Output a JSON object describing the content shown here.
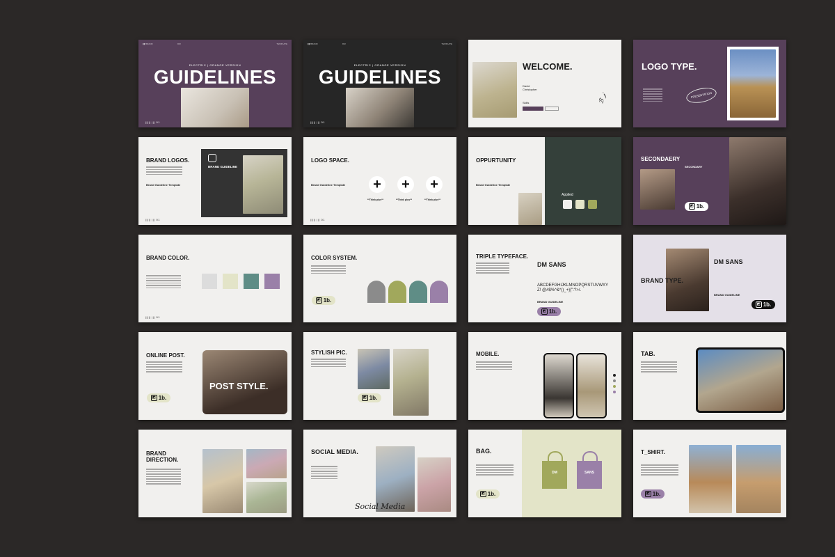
{
  "footer_code": "||||| ||| 01",
  "slide1": {
    "subtitle": "ELECTRIC | ORANGE VERSION",
    "title": "GUIDELINES"
  },
  "slide2": {
    "subtitle": "ELECTRIC | ORANGE VERSION",
    "title": "GUIDELINES"
  },
  "slide3": {
    "title": "WELCOME.",
    "name": "David Christopher",
    "skills": "Skills"
  },
  "slide4": {
    "title": "LOGO TYPE.",
    "oval_text": "PRESENTATION"
  },
  "slide5": {
    "title": "BRAND LOGOS.",
    "panel_title": "BRAND GUIDELINE",
    "caption": "Brand Guideline Template"
  },
  "slide6": {
    "title": "LOGO SPACE.",
    "caption": "Brand Guideline Template",
    "plus_labels": [
      "**Think plus**",
      "**Think plus**",
      "**Think plus**"
    ]
  },
  "slide7": {
    "title": "OPPURTUNITY",
    "caption": "Brand Guideline Template",
    "applied": "Applied"
  },
  "slide8": {
    "title": "SECONDAERY",
    "label": "SECONDARY"
  },
  "slide9": {
    "title": "BRAND COLOR."
  },
  "slide10": {
    "title": "COLOR SYSTEM."
  },
  "slide11": {
    "title": "TRIPLE TYPEFACE.",
    "font": "DM SANS",
    "alphabet": "ABCDEFGHIJKLMNOPQRSTUVWXYZ! @#$%^&*()_+}{\":?>/.",
    "caption": "BRAND GUIDELINE"
  },
  "slide12": {
    "title": "BRAND TYPE.",
    "font": "DM SANS",
    "caption": "BRAND GUIDELINE"
  },
  "slide13": {
    "title": "ONLINE POST.",
    "overlay": "POST STYLE."
  },
  "slide14": {
    "title": "STYLISH PIC."
  },
  "slide15": {
    "title": "MOBILE."
  },
  "slide16": {
    "title": "TAB."
  },
  "slide17": {
    "title": "BRAND DIRECTION."
  },
  "slide18": {
    "title": "SOCIAL MEDIA.",
    "script": "Social Media"
  },
  "slide19": {
    "title": "BAG.",
    "bag1": "DM",
    "bag2": "SANS"
  },
  "slide20": {
    "title": "T_SHIRT."
  },
  "badge_text": "1b.",
  "colors": {
    "purple": "#57405a",
    "olive": "#a1a85c",
    "grey": "#8b8b8b",
    "teal": "#5f8d86",
    "lilac": "#9a80a8",
    "cream": "#e3e4c8"
  }
}
